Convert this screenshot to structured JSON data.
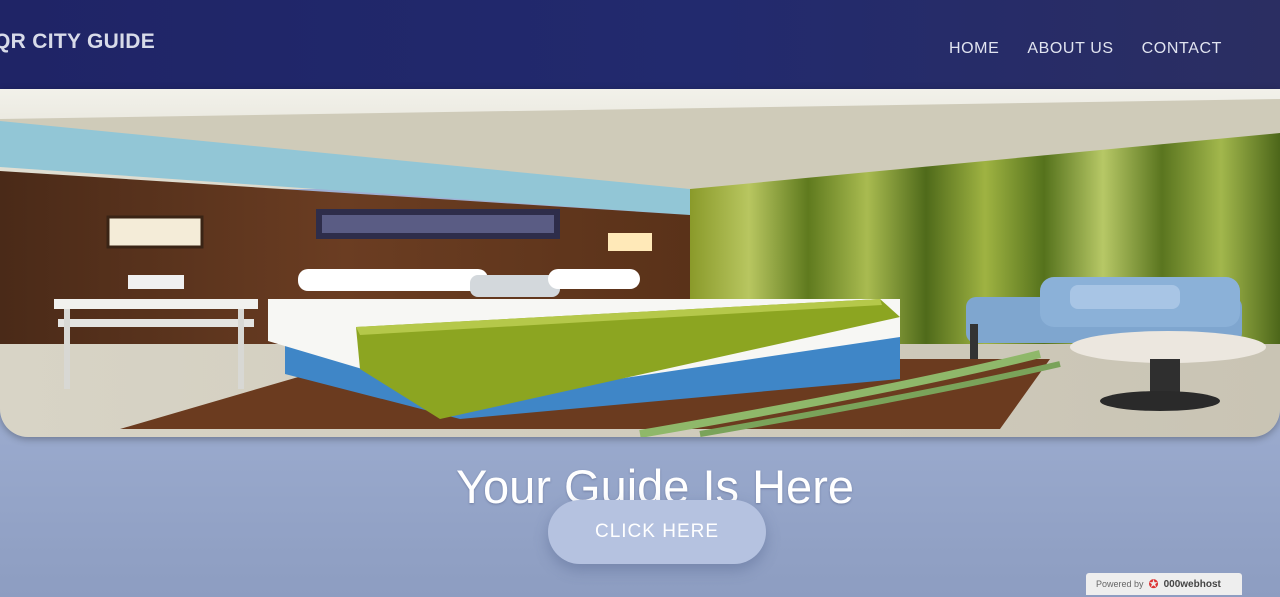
{
  "nav": {
    "brand": "QR CITY GUIDE",
    "links": [
      "HOME",
      "ABOUT US",
      "CONTACT"
    ]
  },
  "hero": {
    "image_alt": "hotel bedroom",
    "tagline": "Your Guide Is Here",
    "cta_label": "CLICK HERE"
  },
  "footer_badge": {
    "prefix": "Powered by",
    "brand": "000webhost"
  },
  "colors": {
    "nav_bg": "#1f2466",
    "page_bg": "#a6b6d9",
    "cta_bg": "#b5c2e0"
  }
}
